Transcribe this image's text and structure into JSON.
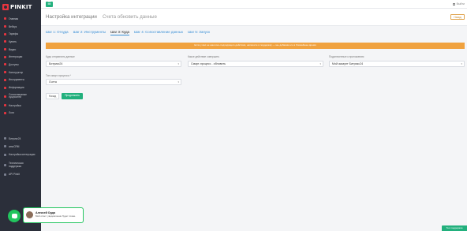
{
  "brand": "PINKIT",
  "topbar": {
    "menu_icon": "☰",
    "logout": "Выйти"
  },
  "sidebar": {
    "items": [
      {
        "label": "Главная",
        "icon": "home-icon"
      },
      {
        "label": "Вебхук",
        "icon": "webhook-icon"
      },
      {
        "label": "Тарифы",
        "icon": "tariff-icon"
      },
      {
        "label": "Купить",
        "icon": "cart-icon"
      },
      {
        "label": "Видео",
        "icon": "video-icon"
      },
      {
        "label": "Интеграции",
        "icon": "integration-icon"
      },
      {
        "label": "Доступы",
        "icon": "key-icon"
      },
      {
        "label": "Конструктор",
        "icon": "builder-icon"
      },
      {
        "label": "Инструменты",
        "icon": "tools-icon"
      },
      {
        "label": "Информация",
        "icon": "info-icon"
      },
      {
        "label": "Сопоставление сущностей",
        "icon": "mapping-icon",
        "double": true
      },
      {
        "label": "Настройки",
        "icon": "settings-icon"
      },
      {
        "label": "Логи",
        "icon": "logs-icon"
      }
    ],
    "secondary": [
      {
        "label": "Битрикс24",
        "icon": "bitrix-icon"
      },
      {
        "label": "amoCRM",
        "icon": "amocrm-icon"
      },
      {
        "label": "Настройки интеграции",
        "icon": "integration-settings-icon",
        "double": true
      },
      {
        "label": "Техническая поддержка",
        "icon": "support-icon",
        "double": true
      },
      {
        "label": "API Pinkit",
        "icon": "api-icon"
      }
    ]
  },
  "header": {
    "title": "Настройка интеграции",
    "subtitle": "Счета обновить данные",
    "back_button": "Назад"
  },
  "steps": [
    {
      "label": "Шаг 1: Откуда",
      "active": false
    },
    {
      "label": "Шаг 2: Инструменты",
      "active": false
    },
    {
      "label": "Шаг 3: Куда",
      "active": true
    },
    {
      "label": "Шаг 4: Сопоставление данных",
      "active": false
    },
    {
      "label": "Шаг 5: Запуск",
      "active": false
    }
  ],
  "alert": "Если у вас не нашлось подходящего действия, напишите в поддержку — мы добавим его в ближайшее время",
  "form": {
    "destination": {
      "label": "Куда отправлять данные",
      "value": "Битрикс24"
    },
    "action": {
      "label": "Какое действие совершить",
      "value": "Смарт-процесс - обновить"
    },
    "account": {
      "label": "Подключенные к приложению",
      "value": "Мой аккаунт Битрикс24"
    },
    "process_type": {
      "label": "Тип смарт-процесса *",
      "value": "Счета"
    },
    "back_button": "Назад",
    "next_button": "Продолжить"
  },
  "chat": {
    "name": "Алексей Орда",
    "message": "Мой ответ: уведомление будет позже.",
    "colors": {
      "accent": "#22c55e"
    }
  },
  "tech_support_button": "Тех.поддержка",
  "colors": {
    "brand_red": "#e8353f",
    "primary_green": "#22b07d",
    "alert_orange": "#f0a23f",
    "sidebar_bg": "#2b2f3a"
  }
}
